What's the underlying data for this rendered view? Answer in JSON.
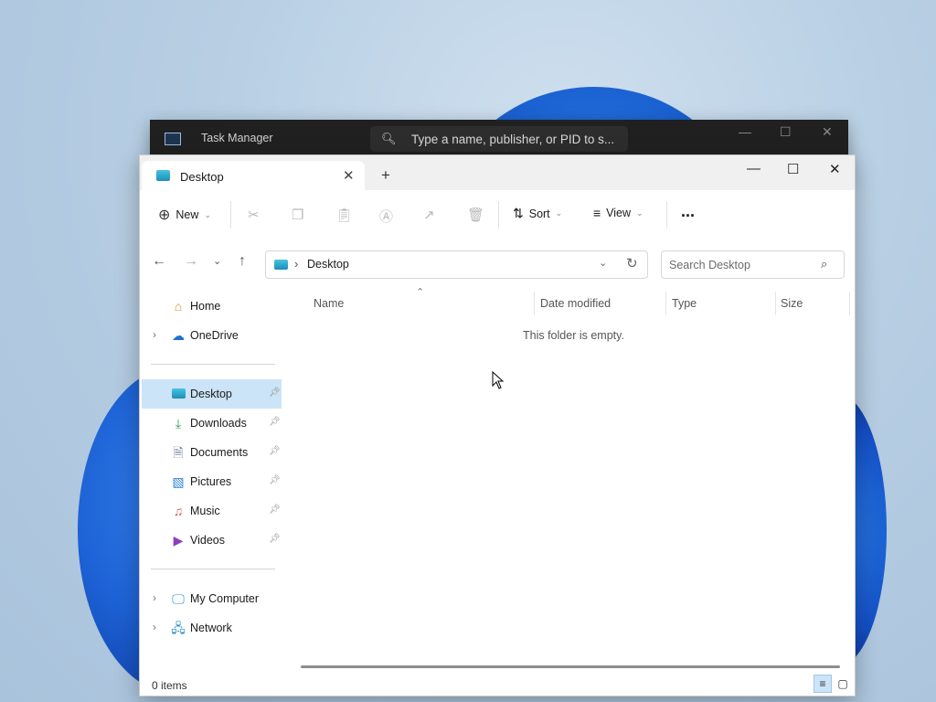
{
  "taskmanager": {
    "title": "Task Manager",
    "search_placeholder": "Type a name, publisher, or PID to s..."
  },
  "explorer": {
    "tab_label": "Desktop",
    "toolbar": {
      "new_label": "New",
      "sort_label": "Sort",
      "view_label": "View",
      "more_label": "..."
    },
    "address": {
      "path": "Desktop",
      "search_placeholder": "Search Desktop"
    },
    "sidebar": {
      "top_items": [
        {
          "label": "Home",
          "icon": "home-icon"
        },
        {
          "label": "OneDrive",
          "icon": "cloud-icon"
        }
      ],
      "quick_access": [
        {
          "label": "Desktop",
          "icon": "desktop-folder-icon"
        },
        {
          "label": "Downloads",
          "icon": "download-icon"
        },
        {
          "label": "Documents",
          "icon": "document-icon"
        },
        {
          "label": "Pictures",
          "icon": "picture-icon"
        },
        {
          "label": "Music",
          "icon": "music-icon"
        },
        {
          "label": "Videos",
          "icon": "video-icon"
        }
      ],
      "bottom_items": [
        {
          "label": "My Computer",
          "icon": "computer-icon"
        },
        {
          "label": "Network",
          "icon": "network-icon"
        }
      ]
    },
    "columns": {
      "name": "Name",
      "date": "Date modified",
      "type": "Type",
      "size": "Size"
    },
    "empty_message": "This folder is empty.",
    "status": {
      "count": "0 items"
    }
  }
}
